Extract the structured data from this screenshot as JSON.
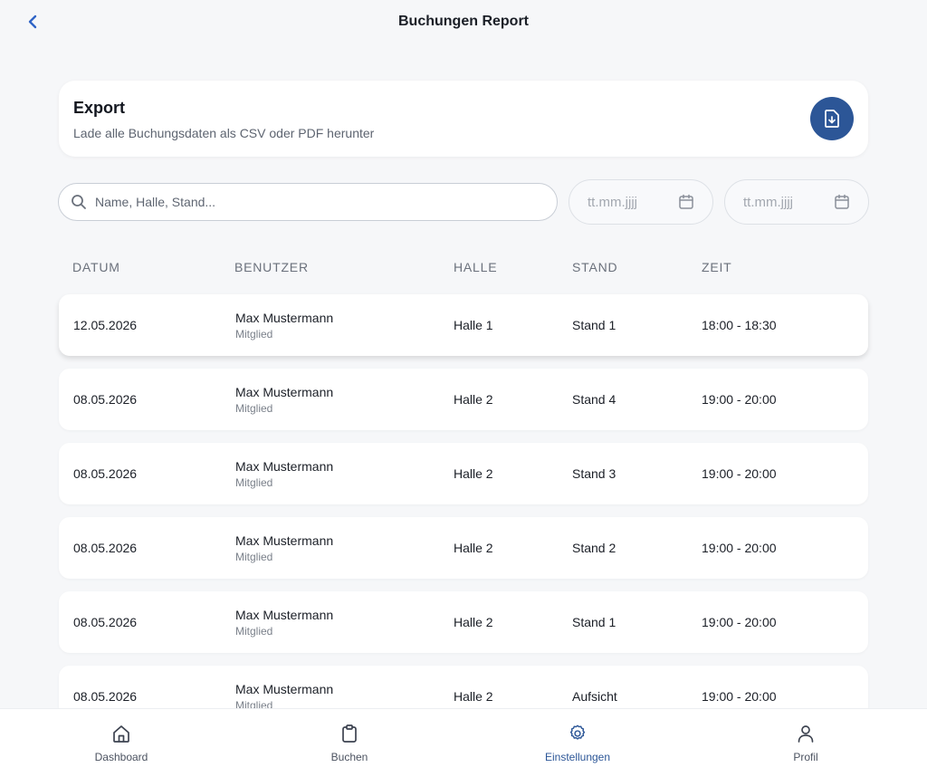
{
  "header": {
    "title": "Buchungen Report"
  },
  "export": {
    "title": "Export",
    "subtitle": "Lade alle Buchungsdaten als CSV oder PDF herunter"
  },
  "filters": {
    "search_placeholder": "Name, Halle, Stand...",
    "date_from_placeholder": "tt.mm.jjjj",
    "date_to_placeholder": "tt.mm.jjjj"
  },
  "table": {
    "columns": [
      "DATUM",
      "BENUTZER",
      "HALLE",
      "STAND",
      "ZEIT"
    ],
    "rows": [
      {
        "date": "12.05.2026",
        "user": "Max Mustermann",
        "role": "Mitglied",
        "hall": "Halle 1",
        "stand": "Stand 1",
        "time": "18:00 - 18:30"
      },
      {
        "date": "08.05.2026",
        "user": "Max Mustermann",
        "role": "Mitglied",
        "hall": "Halle 2",
        "stand": "Stand 4",
        "time": "19:00 - 20:00"
      },
      {
        "date": "08.05.2026",
        "user": "Max Mustermann",
        "role": "Mitglied",
        "hall": "Halle 2",
        "stand": "Stand 3",
        "time": "19:00 - 20:00"
      },
      {
        "date": "08.05.2026",
        "user": "Max Mustermann",
        "role": "Mitglied",
        "hall": "Halle 2",
        "stand": "Stand 2",
        "time": "19:00 - 20:00"
      },
      {
        "date": "08.05.2026",
        "user": "Max Mustermann",
        "role": "Mitglied",
        "hall": "Halle 2",
        "stand": "Stand 1",
        "time": "19:00 - 20:00"
      },
      {
        "date": "08.05.2026",
        "user": "Max Mustermann",
        "role": "Mitglied",
        "hall": "Halle 2",
        "stand": "Aufsicht",
        "time": "19:00 - 20:00"
      }
    ]
  },
  "nav": {
    "items": [
      {
        "label": "Dashboard",
        "icon": "home-icon"
      },
      {
        "label": "Buchen",
        "icon": "clipboard-icon"
      },
      {
        "label": "Einstellungen",
        "icon": "gear-icon"
      },
      {
        "label": "Profil",
        "icon": "user-icon"
      }
    ],
    "active": "Einstellungen"
  },
  "colors": {
    "accent": "#2c5697",
    "back_arrow": "#2f64c6",
    "background": "#f6f7f9"
  }
}
